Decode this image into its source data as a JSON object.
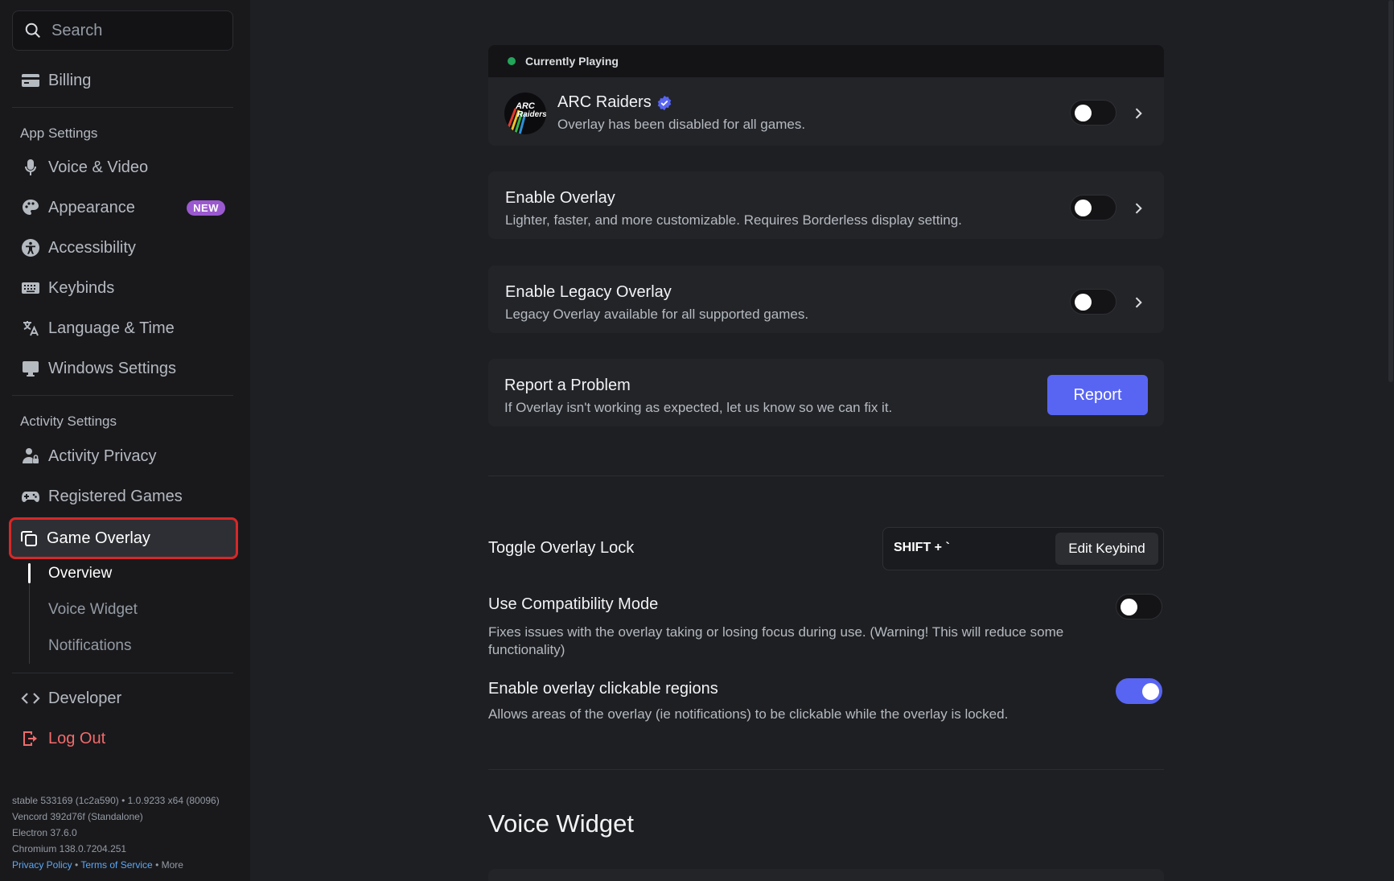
{
  "sidebar": {
    "search_placeholder": "Search",
    "billing": "Billing",
    "app_settings_label": "App Settings",
    "app_items": [
      {
        "label": "Voice & Video"
      },
      {
        "label": "Appearance",
        "badge": "NEW"
      },
      {
        "label": "Accessibility"
      },
      {
        "label": "Keybinds"
      },
      {
        "label": "Language & Time"
      },
      {
        "label": "Windows Settings"
      }
    ],
    "activity_settings_label": "Activity Settings",
    "activity_items": [
      {
        "label": "Activity Privacy"
      },
      {
        "label": "Registered Games"
      },
      {
        "label": "Game Overlay"
      }
    ],
    "sub_items": [
      {
        "label": "Overview"
      },
      {
        "label": "Voice Widget"
      },
      {
        "label": "Notifications"
      }
    ],
    "developer": "Developer",
    "logout": "Log Out",
    "version": {
      "line1": "stable 533169 (1c2a590) • 1.0.9233 x64 (80096)",
      "line2": "Vencord 392d76f (Standalone)",
      "line3": "Electron 37.6.0",
      "line4": "Chromium 138.0.7204.251",
      "privacy": "Privacy Policy",
      "sep1": "•",
      "terms": "Terms of Service",
      "sep2": "•",
      "more": "More"
    }
  },
  "main": {
    "currently_playing_label": "Currently Playing",
    "game": {
      "name": "ARC Raiders",
      "logo_text_1": "ARC",
      "logo_text_2": "Raiders",
      "subtitle": "Overlay has been disabled for all games.",
      "toggle_on": false
    },
    "enable_overlay": {
      "title": "Enable Overlay",
      "subtitle": "Lighter, faster, and more customizable. Requires Borderless display setting.",
      "toggle_on": false
    },
    "enable_legacy": {
      "title": "Enable Legacy Overlay",
      "subtitle": "Legacy Overlay available for all supported games.",
      "toggle_on": false
    },
    "report": {
      "title": "Report a Problem",
      "subtitle": "If Overlay isn't working as expected, let us know so we can fix it.",
      "button": "Report"
    },
    "toggle_lock": {
      "title": "Toggle Overlay Lock",
      "keybind": "SHIFT + `",
      "edit_button": "Edit Keybind"
    },
    "compat_mode": {
      "title": "Use Compatibility Mode",
      "subtitle_1": "Fixes issues with the overlay taking or losing focus during use. (Warning! This will reduce some",
      "subtitle_2": "functionality)",
      "toggle_on": false
    },
    "clickable_regions": {
      "title": "Enable overlay clickable regions",
      "subtitle": "Allows areas of the overlay (ie notifications) to be clickable while the overlay is locked.",
      "toggle_on": true
    },
    "voice_widget_heading": "Voice Widget"
  },
  "colors": {
    "accent": "#5865f2",
    "online": "#23a55a",
    "danger": "#f26b6b",
    "badge": "#9b59d0"
  }
}
